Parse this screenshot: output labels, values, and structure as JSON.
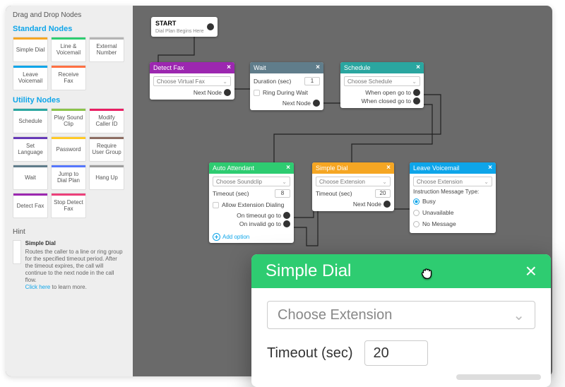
{
  "sidebar": {
    "title": "Drag and Drop Nodes",
    "std_label": "Standard Nodes",
    "util_label": "Utility Nodes",
    "hint_label": "Hint",
    "std": [
      {
        "label": "Simple Dial",
        "c": "#f5a623"
      },
      {
        "label": "Line & Voicemail",
        "c": "#2ecc71"
      },
      {
        "label": "External Number",
        "c": "#b4b4b4"
      },
      {
        "label": "Leave Voicemail",
        "c": "#0ea5e9"
      },
      {
        "label": "Receive Fax",
        "c": "#ff7043"
      }
    ],
    "util": [
      {
        "label": "Schedule",
        "c": "#2aa6a0"
      },
      {
        "label": "Play Sound Clip",
        "c": "#8bc34a"
      },
      {
        "label": "Modify Caller ID",
        "c": "#e91e63"
      },
      {
        "label": "Set Language",
        "c": "#673ab7"
      },
      {
        "label": "Password",
        "c": "#ffca28"
      },
      {
        "label": "Require User Group",
        "c": "#8d6e63"
      },
      {
        "label": "Wait",
        "c": "#607d8b"
      },
      {
        "label": "Jump to Dial Plan",
        "c": "#5677fc"
      },
      {
        "label": "Hang Up",
        "c": "#9e9e9e"
      },
      {
        "label": "Detect Fax",
        "c": "#9c27b0"
      },
      {
        "label": "Stop Detect Fax",
        "c": "#ec407a"
      }
    ],
    "hint": {
      "title": "Simple Dial",
      "body": "Routes the caller to a line or ring group for the specified timeout period. After the timeout expires, the call will continue to the next node in the call flow.",
      "link": "Click here",
      "after": " to learn more."
    }
  },
  "canvas": {
    "start": {
      "title": "START",
      "sub": "Dial Plan Begins Here"
    },
    "detect": {
      "title": "Detect Fax",
      "select": "Choose Virtual Fax",
      "port": "Next Node"
    },
    "wait": {
      "title": "Wait",
      "dur_lbl": "Duration (sec)",
      "dur_val": "1",
      "ring": "Ring During Wait",
      "port": "Next Node"
    },
    "schedule": {
      "title": "Schedule",
      "select": "Choose Schedule",
      "open": "When open go to",
      "closed": "When closed go to"
    },
    "auto": {
      "title": "Auto Attendant",
      "select": "Choose Soundclip",
      "to_lbl": "Timeout (sec)",
      "to_val": "8",
      "allow": "Allow Extension Dialing",
      "p1": "On timeout go to",
      "p2": "On invalid go to",
      "add": "Add option"
    },
    "simple": {
      "title": "Simple Dial",
      "select": "Choose Extension",
      "to_lbl": "Timeout (sec)",
      "to_val": "20",
      "port": "Next Node"
    },
    "voicemail": {
      "title": "Leave Voicemail",
      "select": "Choose Extension",
      "msg": "Instruction Message Type:",
      "o1": "Busy",
      "o2": "Unavailable",
      "o3": "No Message"
    }
  },
  "overlay": {
    "title": "Simple Dial",
    "select": "Choose Extension",
    "to_lbl": "Timeout (sec)",
    "to_val": "20"
  }
}
